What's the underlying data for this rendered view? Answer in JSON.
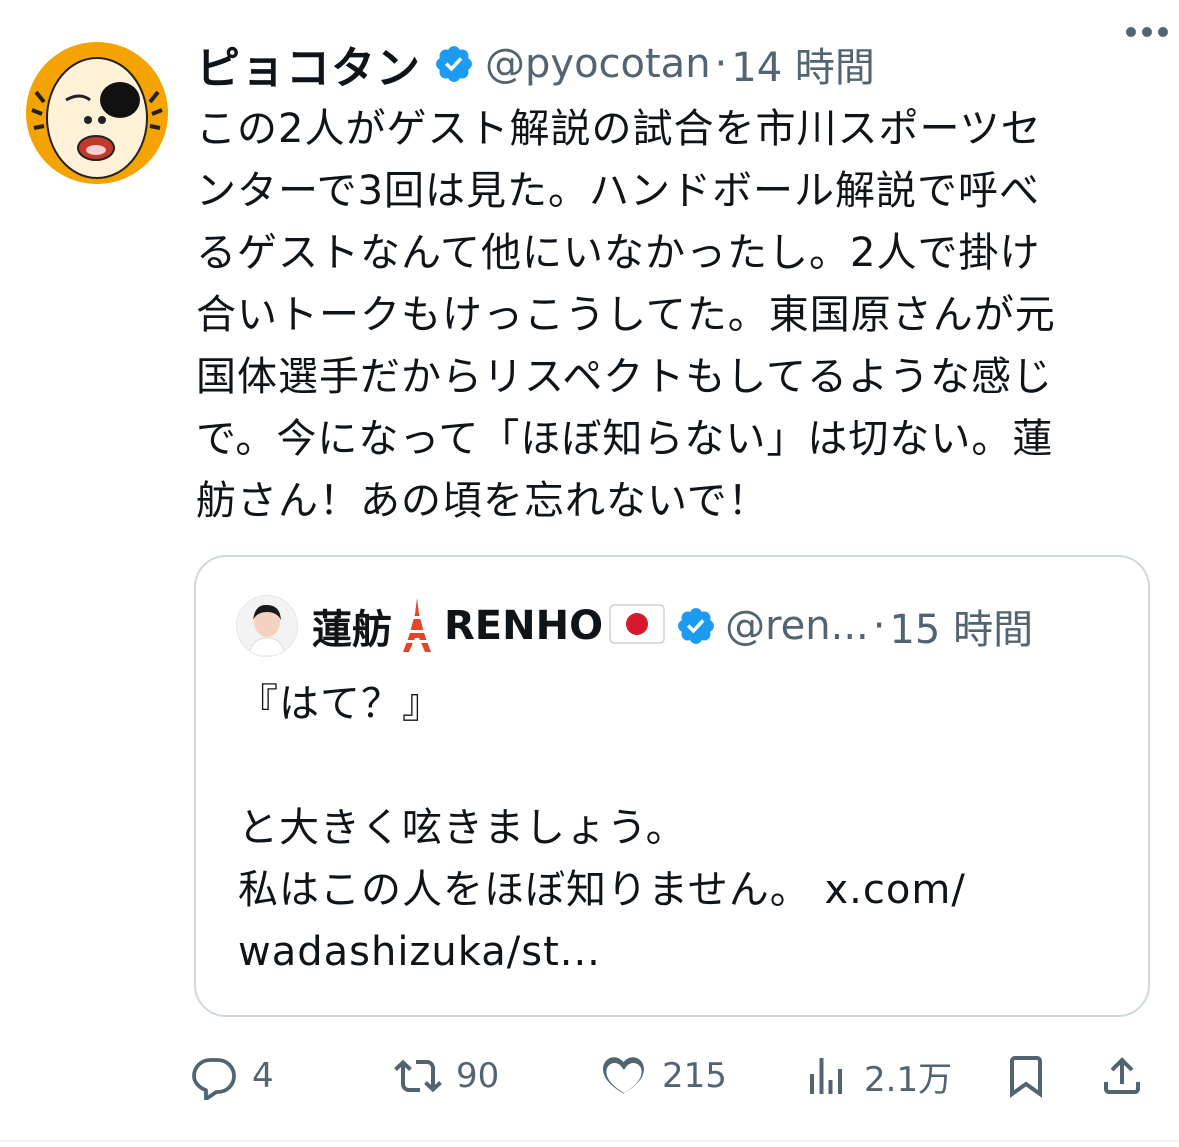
{
  "tweet": {
    "author": {
      "display_name": "ピョコタン",
      "handle": "@pyocotan",
      "avatar_icon": "cartoon-face-avatar",
      "verified": true
    },
    "separator": "·",
    "time": "14 時間",
    "more_icon": "more-options-icon",
    "text": "この2人がゲスト解説の試合を市川スポーツセ\nンターで3回は見た。ハンドボール解説で呼べ\nるゲストなんて他にいなかったし。2人で掛け\n合いトークもけっこうしてた。東国原さんが元\n国体選手だからリスペクトもしてるような感じ\nで。今になって「ほぼ知らない」は切ない。蓮\n舫さん！あの頃を忘れないで！"
  },
  "quoted": {
    "author": {
      "display_name": "蓮舫",
      "name_suffix": "RENHO",
      "handle": "@ren...",
      "avatar_icon": "profile-photo-avatar",
      "verified": true
    },
    "separator": "·",
    "time": "15 時間",
    "text": "『はて？』\n\nと大きく呟きましょう。\n私はこの人をほぼ知りません。 x.com/\nwadashizuka/st..."
  },
  "actions": {
    "reply": {
      "icon": "reply-icon",
      "count": "4"
    },
    "retweet": {
      "icon": "retweet-icon",
      "count": "90"
    },
    "like": {
      "icon": "heart-icon",
      "count": "215"
    },
    "views": {
      "icon": "views-chart-icon",
      "count": "2.1万"
    },
    "bookmark": {
      "icon": "bookmark-icon"
    },
    "share": {
      "icon": "share-icon"
    }
  },
  "colors": {
    "text": "#0f1419",
    "secondary": "#536471",
    "verified": "#1d9bf0",
    "border": "#cfd9de",
    "avatar_bg": "#f4a300"
  }
}
